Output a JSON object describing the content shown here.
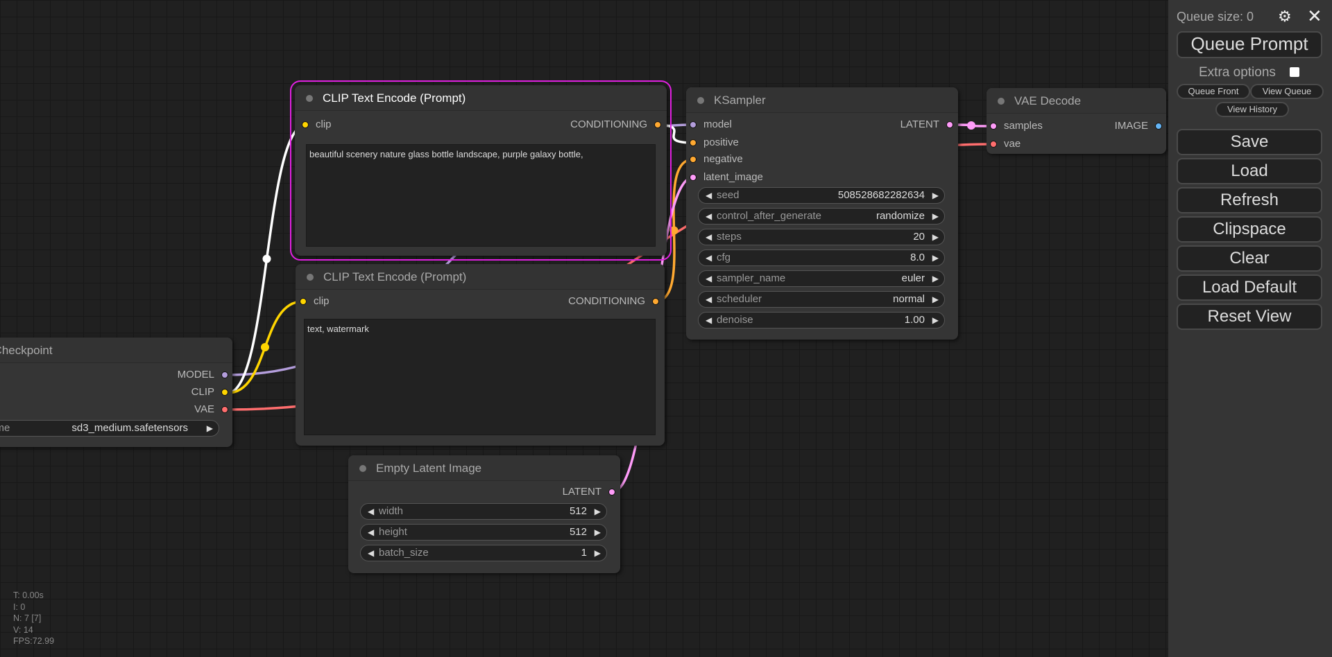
{
  "panel": {
    "queue_size": "Queue size: 0",
    "queue_prompt": "Queue Prompt",
    "extra_options": "Extra options",
    "queue_front": "Queue Front",
    "view_queue": "View Queue",
    "view_history": "View History",
    "buttons": [
      "Save",
      "Load",
      "Refresh",
      "Clipspace",
      "Clear",
      "Load Default",
      "Reset View"
    ]
  },
  "nodes": {
    "clip1": {
      "title": "CLIP Text Encode (Prompt)",
      "input": "clip",
      "output": "CONDITIONING",
      "text": "beautiful scenery nature glass bottle landscape, purple galaxy bottle,"
    },
    "clip2": {
      "title": "CLIP Text Encode (Prompt)",
      "input": "clip",
      "output": "CONDITIONING",
      "text": "text, watermark"
    },
    "ksampler": {
      "title": "KSampler",
      "inputs": [
        "model",
        "positive",
        "negative",
        "latent_image"
      ],
      "output": "LATENT",
      "widgets": [
        {
          "name": "seed",
          "value": "508528682282634"
        },
        {
          "name": "control_after_generate",
          "value": "randomize"
        },
        {
          "name": "steps",
          "value": "20"
        },
        {
          "name": "cfg",
          "value": "8.0"
        },
        {
          "name": "sampler_name",
          "value": "euler"
        },
        {
          "name": "scheduler",
          "value": "normal"
        },
        {
          "name": "denoise",
          "value": "1.00"
        }
      ]
    },
    "vae": {
      "title": "VAE Decode",
      "inputs": [
        "samples",
        "vae"
      ],
      "output": "IMAGE"
    },
    "ckpt": {
      "title": "Load Checkpoint",
      "outputs": [
        "MODEL",
        "CLIP",
        "VAE"
      ],
      "widget": {
        "name": "ckpt_name",
        "value": "sd3_medium.safetensors"
      }
    },
    "latent": {
      "title": "Empty Latent Image",
      "output": "LATENT",
      "widgets": [
        {
          "name": "width",
          "value": "512"
        },
        {
          "name": "height",
          "value": "512"
        },
        {
          "name": "batch_size",
          "value": "1"
        }
      ]
    }
  },
  "stats": [
    "T: 0.00s",
    "I: 0",
    "N: 7 [7]",
    "V: 14",
    "FPS:72.99"
  ],
  "colors": {
    "model": "#b39ddb",
    "clip": "#ffd500",
    "vae": "#ff6e6e",
    "conditioning": "#ffa931",
    "latent": "#ff9cf9",
    "image": "#64b5f6",
    "selected": "#e020e0"
  }
}
